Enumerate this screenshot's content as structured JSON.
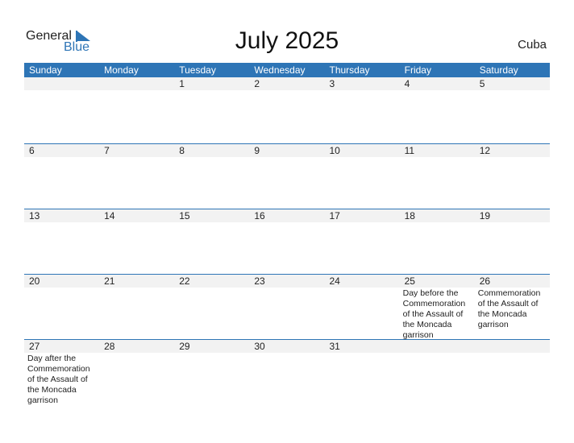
{
  "logo": {
    "text1": "General",
    "text2": "Blue"
  },
  "title": "July 2025",
  "country": "Cuba",
  "colors": {
    "accent": "#2e75b6",
    "daterow": "#f2f2f2"
  },
  "weekdays": [
    "Sunday",
    "Monday",
    "Tuesday",
    "Wednesday",
    "Thursday",
    "Friday",
    "Saturday"
  ],
  "weeks": [
    {
      "days": [
        "",
        "",
        "1",
        "2",
        "3",
        "4",
        "5"
      ],
      "events": [
        "",
        "",
        "",
        "",
        "",
        "",
        ""
      ]
    },
    {
      "days": [
        "6",
        "7",
        "8",
        "9",
        "10",
        "11",
        "12"
      ],
      "events": [
        "",
        "",
        "",
        "",
        "",
        "",
        ""
      ]
    },
    {
      "days": [
        "13",
        "14",
        "15",
        "16",
        "17",
        "18",
        "19"
      ],
      "events": [
        "",
        "",
        "",
        "",
        "",
        "",
        ""
      ]
    },
    {
      "days": [
        "20",
        "21",
        "22",
        "23",
        "24",
        "25",
        "26"
      ],
      "events": [
        "",
        "",
        "",
        "",
        "",
        "Day before the Commemoration of the Assault of the Moncada garrison",
        "Commemoration of the Assault of the Moncada garrison"
      ]
    },
    {
      "days": [
        "27",
        "28",
        "29",
        "30",
        "31",
        "",
        ""
      ],
      "events": [
        "Day after the Commemoration of the Assault of the Moncada garrison",
        "",
        "",
        "",
        "",
        "",
        ""
      ]
    }
  ]
}
